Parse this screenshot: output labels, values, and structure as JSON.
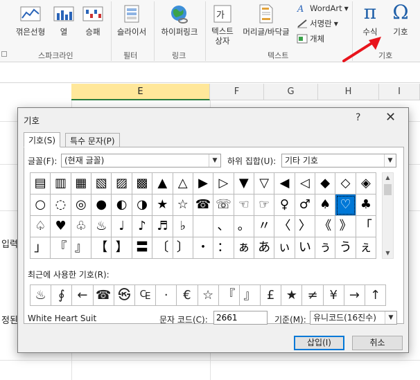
{
  "ribbon": {
    "sparkline_line": "꺾은선형",
    "sparkline_column": "열",
    "sparkline_winloss": "승패",
    "slicer": "슬라이서",
    "hyperlink": "하이퍼링크",
    "textbox": "텍스트\n상자",
    "header_footer": "머리글/바닥글",
    "wordart": "WordArt",
    "signature_line": "서명란",
    "object": "개체",
    "equation": "수식",
    "symbol": "기호",
    "groups": {
      "sparklines": "스파크라인",
      "filters": "필터",
      "links": "링크",
      "text": "텍스트",
      "symbols": "기호"
    }
  },
  "sheet": {
    "columns": [
      "E",
      "F",
      "G",
      "H",
      "I"
    ],
    "selected_column": "E",
    "left_text_1": "입력",
    "left_text_2": "정된"
  },
  "dialog": {
    "title": "기호",
    "help": "?",
    "close": "✕",
    "tabs": [
      "기호(S)",
      "특수 문자(P)"
    ],
    "font_label": "글꼴(F):",
    "font_value": "(현재 글꼴)",
    "subset_label": "하위 집합(U):",
    "subset_value": "기타 기호",
    "symbols": [
      [
        "▤",
        "▥",
        "▦",
        "▧",
        "▨",
        "▩",
        "▲",
        "△",
        "▶",
        "▷",
        "▼",
        "▽",
        "◀",
        "◁",
        "◆",
        "◇",
        "◈"
      ],
      [
        "○",
        "◌",
        "◎",
        "●",
        "◐",
        "◑",
        "★",
        "☆",
        "☎",
        "☏",
        "☜",
        "☞",
        "♀",
        "♂",
        "♠",
        "♡",
        "♣"
      ],
      [
        "♤",
        "♥",
        "♧",
        "♨",
        "♩",
        "♪",
        "♬",
        "♭",
        "　",
        "、",
        "。",
        "〃",
        "〈",
        "〉",
        "《",
        "》",
        "「"
      ],
      [
        "」",
        "『",
        "』",
        "【",
        "】",
        "〓",
        "〔",
        "〕",
        "・",
        "：",
        "ぁ",
        "あ",
        "ぃ",
        "い",
        "ぅ",
        "う",
        "ぇ"
      ]
    ],
    "selected_symbol": "♡",
    "recent_label": "최근에 사용한 기호(R):",
    "recent": [
      "♨",
      "∮",
      "←",
      "☎",
      "㉿",
      "₠",
      "·",
      "€",
      "☆",
      "『",
      "』",
      "£",
      "★",
      "≠",
      "¥",
      "→",
      "↑"
    ],
    "char_name": "White Heart Suit",
    "code_label": "문자 코드(C):",
    "code_value": "2661",
    "from_label": "기준(M):",
    "from_value": "유니코드(16진수)",
    "insert_button": "삽입(I)",
    "cancel_button": "취소"
  },
  "colors": {
    "selection": "#0078d7",
    "column_highlight": "#ffe79a",
    "arrow": "#e8141c",
    "equation_icon": "#1f5fa8"
  }
}
